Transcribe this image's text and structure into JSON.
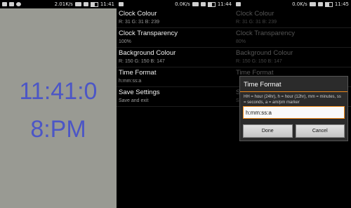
{
  "panel1": {
    "status": {
      "speed": "2.01K/s",
      "time": "11:41"
    },
    "clock": {
      "line1": "11:41:0",
      "line2": "8:PM"
    }
  },
  "panel2": {
    "status": {
      "speed": "0.0K/s",
      "time": "11:44"
    },
    "settings": [
      {
        "title": "Clock Colour",
        "value": "R: 31 G: 31 B: 239"
      },
      {
        "title": "Clock Transparency",
        "value": "100%"
      },
      {
        "title": "Background Colour",
        "value": "R: 150 G: 150 B: 147"
      },
      {
        "title": "Time Format",
        "value": "h:mm:ss:a"
      },
      {
        "title": "Save Settings",
        "value": "Save and exit"
      }
    ]
  },
  "panel3": {
    "status": {
      "speed": "0.0K/s",
      "time": "11:45"
    },
    "settings": [
      {
        "title": "Clock Colour",
        "value": "R: 31 G: 31 B: 239"
      },
      {
        "title": "Clock Transparency",
        "value": "80%"
      },
      {
        "title": "Background Colour",
        "value": "R: 150 G: 150 B: 147"
      },
      {
        "title": "Time Format",
        "value": ""
      },
      {
        "title": "S",
        "value": "S"
      }
    ],
    "dialog": {
      "title": "Time Format",
      "help": "HH = hour (24hr), h = hour (12hr), mm = minutes, ss = seconds, a = am/pm marker",
      "input_value": "h:mm:ss:a",
      "done_label": "Done",
      "cancel_label": "Cancel"
    }
  },
  "colors": {
    "clock_text": "#4c56c6",
    "clock_bg": "#999a93",
    "accent": "#f08a1a"
  }
}
